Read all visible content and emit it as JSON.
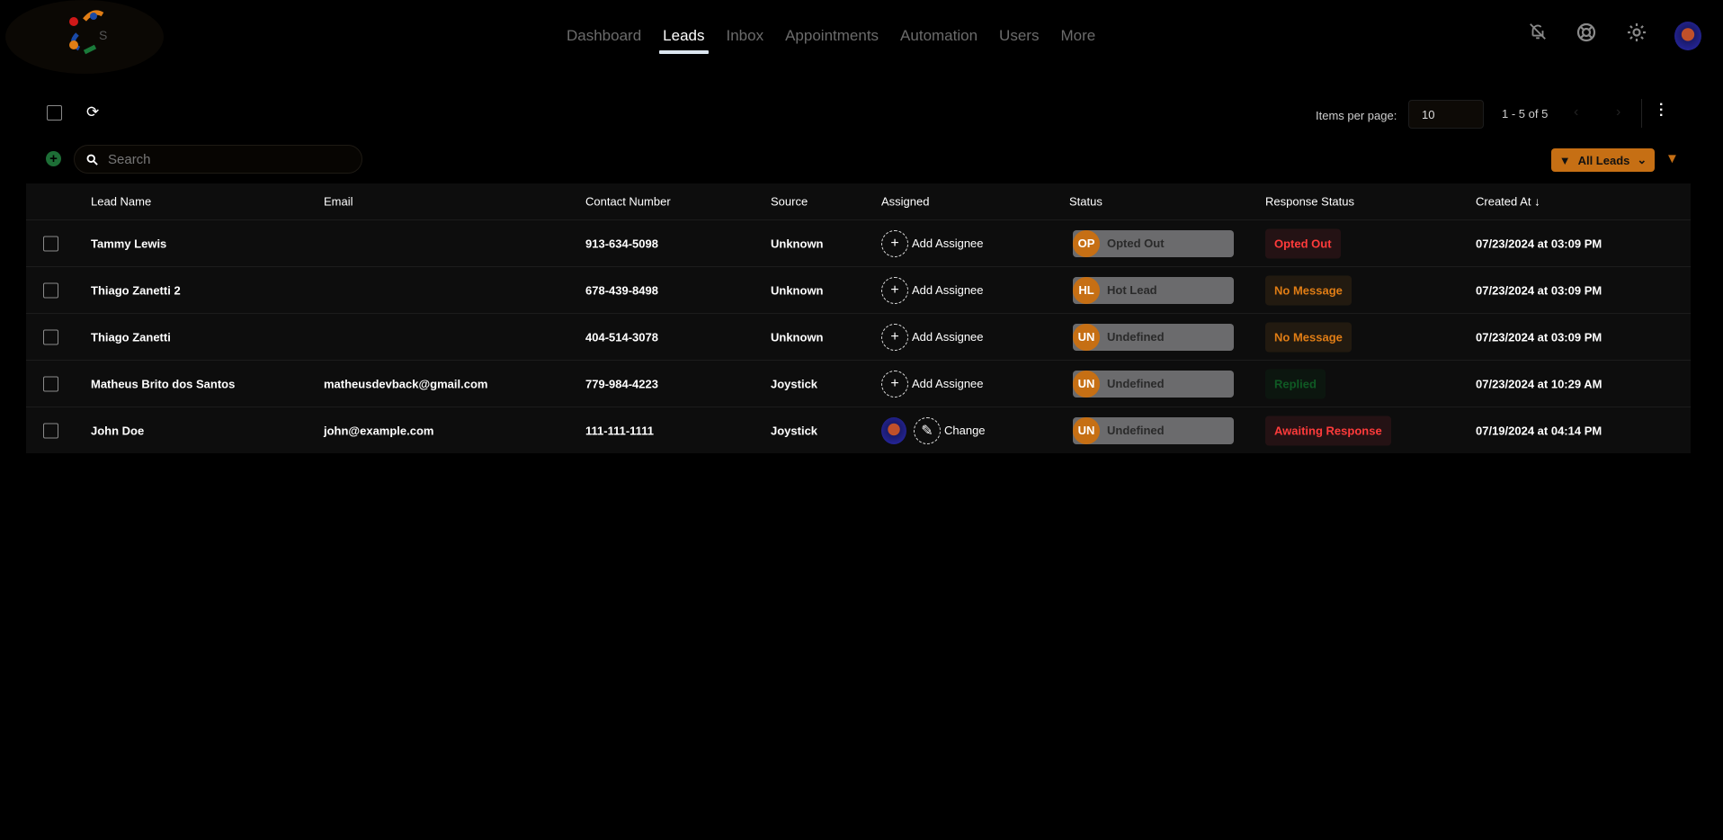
{
  "nav": {
    "items": [
      "Dashboard",
      "Leads",
      "Inbox",
      "Appointments",
      "Automation",
      "Users",
      "More"
    ],
    "active": "Leads"
  },
  "toolbar": {
    "items_per_page_label": "Items per page:",
    "items_per_page": "10",
    "range": "1 - 5 of 5"
  },
  "search": {
    "placeholder": "Search"
  },
  "filter": {
    "label": "All Leads"
  },
  "table": {
    "headers": [
      "Lead Name",
      "Email",
      "Contact Number",
      "Source",
      "Assigned",
      "Status",
      "Response Status",
      "Created At"
    ],
    "rows": [
      {
        "name": "Tammy Lewis",
        "email": "",
        "phone": "913-634-5098",
        "source": "Unknown",
        "assigned": "Add Assignee",
        "status_abbr": "OP",
        "status": "Opted Out",
        "response": "Opted Out",
        "response_color": "#ff3b3b",
        "response_bg": "#241214",
        "created": "07/23/2024 at 03:09 PM"
      },
      {
        "name": "Thiago Zanetti 2",
        "email": "",
        "phone": "678-439-8498",
        "source": "Unknown",
        "assigned": "Add Assignee",
        "status_abbr": "HL",
        "status": "Hot Lead",
        "response": "No Message",
        "response_color": "#e07d15",
        "response_bg": "#221a10",
        "created": "07/23/2024 at 03:09 PM"
      },
      {
        "name": "Thiago Zanetti",
        "email": "",
        "phone": "404-514-3078",
        "source": "Unknown",
        "assigned": "Add Assignee",
        "status_abbr": "UN",
        "status": "Undefined",
        "response": "No Message",
        "response_color": "#e07d15",
        "response_bg": "#221a10",
        "created": "07/23/2024 at 03:09 PM"
      },
      {
        "name": "Matheus Brito dos Santos",
        "email": "matheusdevback@gmail.com",
        "phone": "779-984-4223",
        "source": "Joystick",
        "assigned": "Add Assignee",
        "status_abbr": "UN",
        "status": "Undefined",
        "response": "Replied",
        "response_color": "#0f5a24",
        "response_bg": "#0c160f",
        "created": "07/23/2024 at 10:29 AM"
      },
      {
        "name": "John Doe",
        "email": "john@example.com",
        "phone": "111-111-1111",
        "source": "Joystick",
        "assigned": "Change",
        "assigned_avatar": true,
        "status_abbr": "UN",
        "status": "Undefined",
        "response": "Awaiting Response",
        "response_color": "#ff3b3b",
        "response_bg": "#241214",
        "created": "07/19/2024 at 04:14 PM"
      }
    ]
  }
}
